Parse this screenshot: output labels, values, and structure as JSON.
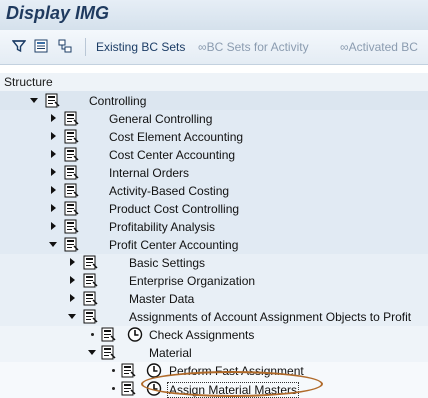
{
  "window": {
    "title": "Display IMG"
  },
  "toolbar": {
    "existing_bc_sets": "Existing BC Sets",
    "bc_sets_for_activity": "BC Sets for Activity",
    "activated_bc": "Activated BC"
  },
  "structure": {
    "header": "Structure"
  },
  "tree": {
    "controlling": "Controlling",
    "general_controlling": "General Controlling",
    "cost_element_accounting": "Cost Element Accounting",
    "cost_center_accounting": "Cost Center Accounting",
    "internal_orders": "Internal Orders",
    "activity_based_costing": "Activity-Based Costing",
    "product_cost_controlling": "Product Cost Controlling",
    "profitability_analysis": "Profitability Analysis",
    "profit_center_accounting": "Profit Center Accounting",
    "basic_settings": "Basic Settings",
    "enterprise_organization": "Enterprise Organization",
    "master_data": "Master Data",
    "assignments": "Assignments of Account Assignment Objects to Profit",
    "check_assignments": "Check Assignments",
    "material": "Material",
    "perform_fast_assignment": "Perform Fast Assignment",
    "assign_material_masters": "Assign Material Masters"
  },
  "colors": {
    "highlight_ellipse": "#b06a2a",
    "title": "#1f3a5f"
  }
}
